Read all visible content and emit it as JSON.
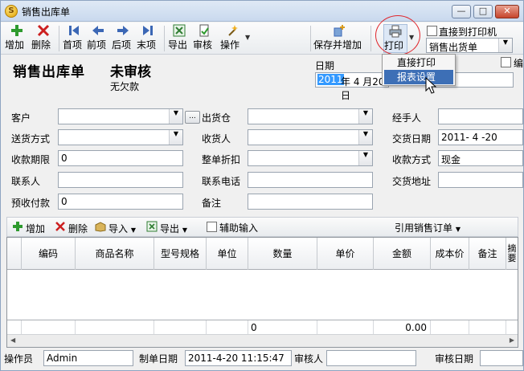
{
  "window": {
    "title": "销售出库单",
    "app_icon_glyph": "S",
    "min_glyph": "—",
    "max_glyph": "□",
    "close_glyph": "✕"
  },
  "toolbar": {
    "add": "增加",
    "delete": "删除",
    "first": "首项",
    "prev": "前项",
    "next": "后项",
    "last": "末项",
    "export": "导出",
    "review": "审核",
    "operation": "操作",
    "save_add": "保存并增加",
    "print": "打印",
    "direct_to_printer": "直接到打印机",
    "print_template": "销售出货单",
    "edit_partial": "编"
  },
  "print_menu": {
    "items": [
      "直接打印",
      "报表设置"
    ]
  },
  "header": {
    "title": "销售出库单",
    "status": "未审核",
    "sub_status": "无欠款",
    "date_label": "日期",
    "date_selected": "2011",
    "date_rest": "年 4 月20日"
  },
  "form": {
    "customer_label": "客户",
    "customer_value": "",
    "warehouse_label": "出货仓",
    "warehouse_value": "",
    "handler_label": "经手人",
    "handler_value": "",
    "delivery_method_label": "送货方式",
    "delivery_method_value": "",
    "receiver_label": "收货人",
    "receiver_value": "",
    "delivery_date_label": "交货日期",
    "delivery_date_value": "2011- 4 -20",
    "payment_term_label": "收款期限",
    "payment_term_value": "0",
    "discount_label": "整单折扣",
    "discount_value": "",
    "payment_method_label": "收款方式",
    "payment_method_value": "现金",
    "contact_label": "联系人",
    "contact_value": "",
    "phone_label": "联系电话",
    "phone_value": "",
    "delivery_address_label": "交货地址",
    "delivery_address_value": "",
    "prepaid_label": "预收付款",
    "prepaid_value": "0",
    "remark_label": "备注",
    "remark_value": "",
    "ellipsis": "..."
  },
  "detail_toolbar": {
    "add": "增加",
    "delete": "删除",
    "import": "导入",
    "export": "导出",
    "assist_input": "辅助输入",
    "ref_order": "引用销售订单"
  },
  "grid": {
    "columns": [
      "编码",
      "商品名称",
      "型号规格",
      "单位",
      "数量",
      "单价",
      "金额",
      "成本价",
      "备注",
      "摘要"
    ],
    "footer_qty": "0",
    "footer_amount": "0.00"
  },
  "statusbar": {
    "operator_label": "操作员",
    "operator_value": "Admin",
    "make_date_label": "制单日期",
    "make_date_value": "2011-4-20 11:15:47",
    "reviewer_label": "审核人",
    "reviewer_value": "",
    "review_date_label": "审核日期",
    "review_date_value": ""
  },
  "colors": {
    "accent_red": "#e0262c",
    "menu_highlight": "#3d6fb6",
    "selection_blue": "#3399ff"
  }
}
